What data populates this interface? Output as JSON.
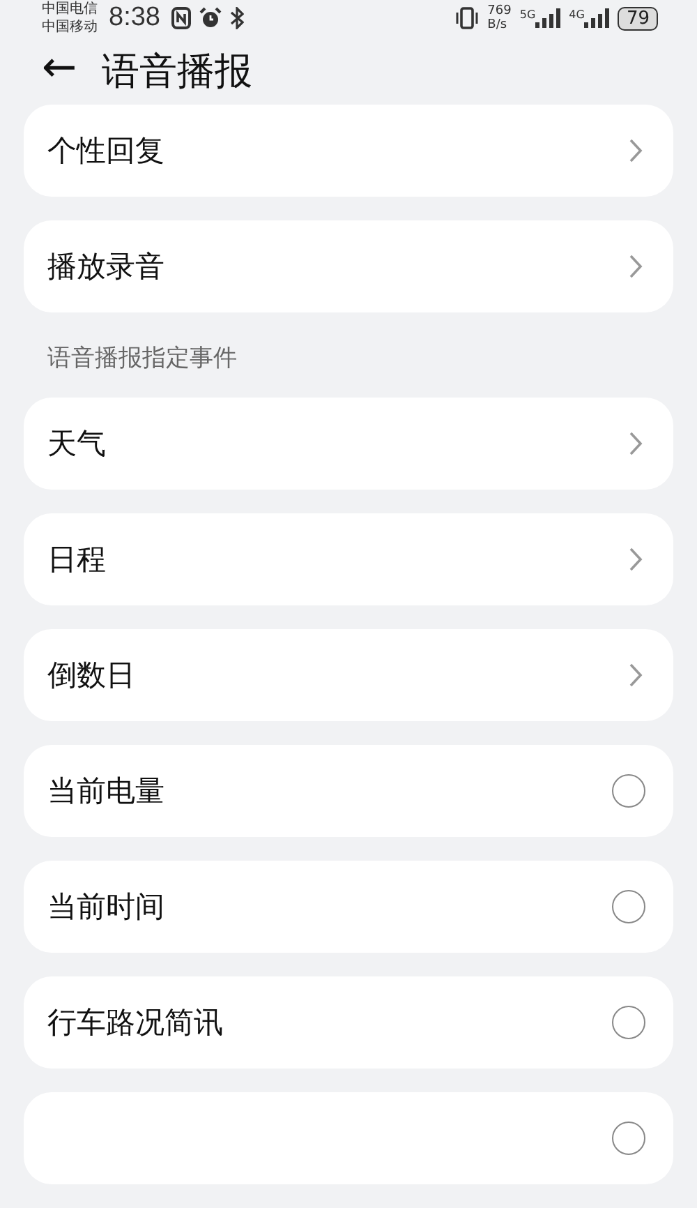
{
  "status_bar": {
    "carriers": [
      "中国电信",
      "中国移动"
    ],
    "time": "8:38",
    "speed_value": "769",
    "speed_unit": "B/s",
    "network_1": "5G",
    "network_2": "4G",
    "battery": "79"
  },
  "header": {
    "back": "←",
    "title": "语音播报"
  },
  "groups": [
    {
      "items": [
        {
          "kind": "link",
          "label": "个性回复"
        }
      ]
    },
    {
      "items": [
        {
          "kind": "link",
          "label": "播放录音"
        }
      ]
    },
    {
      "section": "语音播报指定事件",
      "items": [
        {
          "kind": "link",
          "label": "天气"
        }
      ]
    },
    {
      "items": [
        {
          "kind": "link",
          "label": "日程"
        }
      ]
    },
    {
      "items": [
        {
          "kind": "link",
          "label": "倒数日"
        }
      ]
    },
    {
      "items": [
        {
          "kind": "radio",
          "label": "当前电量",
          "checked": false
        }
      ]
    },
    {
      "items": [
        {
          "kind": "radio",
          "label": "当前时间",
          "checked": false
        }
      ]
    },
    {
      "items": [
        {
          "kind": "radio",
          "label": "行车路况简讯",
          "checked": false
        }
      ]
    },
    {
      "items": [
        {
          "kind": "radio",
          "checked": false
        }
      ]
    }
  ]
}
